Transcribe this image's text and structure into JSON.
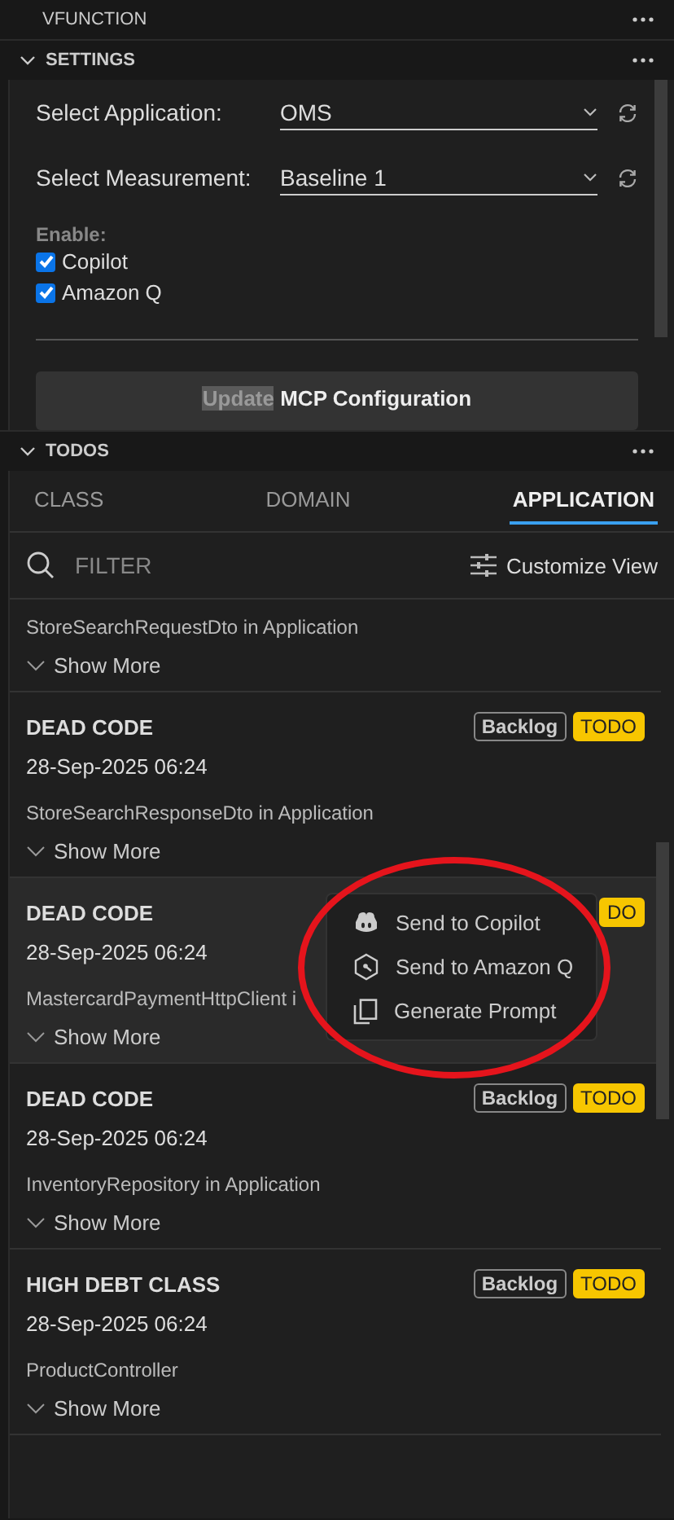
{
  "view_title": "VFUNCTION",
  "settings": {
    "title": "SETTINGS",
    "expanded": true,
    "selects": [
      {
        "label": "Select Application:",
        "value": "OMS"
      },
      {
        "label": "Select Measurement:",
        "value": "Baseline 1"
      }
    ],
    "enable_label": "Enable:",
    "checkboxes": [
      {
        "label": "Copilot",
        "checked": true
      },
      {
        "label": "Amazon Q",
        "checked": true
      }
    ],
    "update_button": {
      "selected_text": "Update",
      "rest_text": "MCP Configuration"
    }
  },
  "todos": {
    "title": "TODOS",
    "expanded": true,
    "tabs": [
      {
        "label": "CLASS",
        "selected": false
      },
      {
        "label": "DOMAIN",
        "selected": false
      },
      {
        "label": "APPLICATION",
        "selected": true
      }
    ],
    "filter": {
      "placeholder": "FILTER"
    },
    "customize": "Customize View",
    "cards": [
      {
        "text": "StoreSearchRequestDto in Application",
        "show_more": "Show More",
        "hovered": false
      },
      {
        "title": "DEAD CODE",
        "date": "28-Sep-2025 06:24",
        "badges": [
          {
            "kind": "backlog",
            "text": "Backlog"
          },
          {
            "kind": "todo",
            "text": "TODO"
          }
        ],
        "text": "StoreSearchResponseDto in Application",
        "show_more": "Show More",
        "hovered": false
      },
      {
        "title": "DEAD CODE",
        "date": "28-Sep-2025 06:24",
        "badges": [
          {
            "kind": "todo",
            "text": "DO"
          }
        ],
        "text": "MastercardPaymentHttpClient i",
        "show_more": "Show More",
        "hovered": true
      },
      {
        "title": "DEAD CODE",
        "date": "28-Sep-2025 06:24",
        "badges": [
          {
            "kind": "backlog",
            "text": "Backlog"
          },
          {
            "kind": "todo",
            "text": "TODO"
          }
        ],
        "text": "InventoryRepository in Application",
        "show_more": "Show More",
        "hovered": false
      },
      {
        "title": "HIGH DEBT CLASS",
        "date": "28-Sep-2025 06:24",
        "badges": [
          {
            "kind": "backlog",
            "text": "Backlog"
          },
          {
            "kind": "todo",
            "text": "TODO"
          }
        ],
        "text": "ProductController",
        "show_more": "Show More",
        "hovered": false
      }
    ]
  },
  "context_menu": {
    "items": [
      {
        "kind": "copilot",
        "label": "Send to Copilot"
      },
      {
        "kind": "amazonq",
        "label": "Send to Amazon Q"
      },
      {
        "kind": "copy",
        "label": "Generate Prompt"
      }
    ]
  }
}
